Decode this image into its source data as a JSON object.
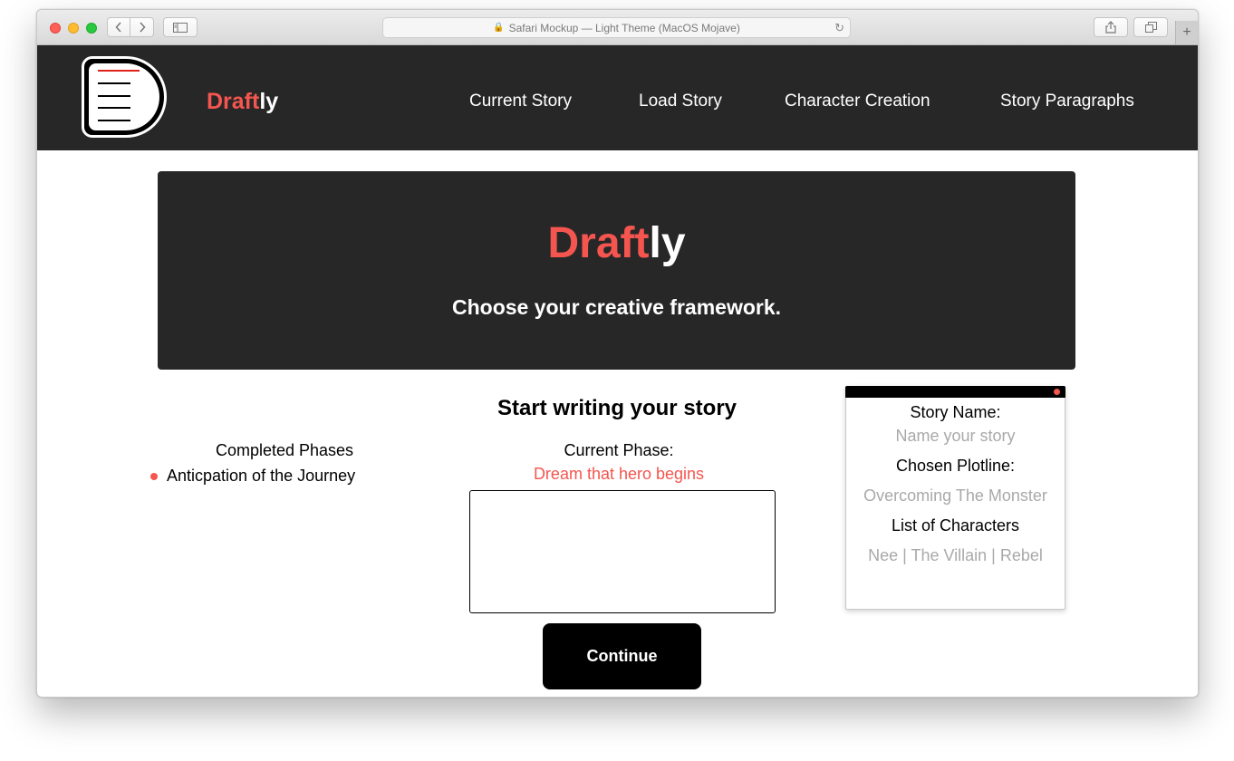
{
  "browser": {
    "address_text": "Safari Mockup — Light Theme (MacOS Mojave)",
    "back_icon": "chevron-left-icon",
    "forward_icon": "chevron-right-icon",
    "new_tab_label": "+"
  },
  "header": {
    "brand_accent": "Draft",
    "brand_rest": "ly",
    "nav": [
      "Current Story",
      "Load Story",
      "Character Creation",
      "Story Paragraphs"
    ]
  },
  "hero": {
    "title_accent": "Draft",
    "title_rest": "ly",
    "subtitle": "Choose your creative framework."
  },
  "main": {
    "title": "Start writing your story",
    "completed_title": "Completed Phases",
    "completed_items": [
      "Anticpation of the Journey"
    ],
    "current_label": "Current Phase:",
    "current_value": "Dream that hero begins",
    "story_text": "",
    "continue_label": "Continue"
  },
  "card": {
    "story_name_label": "Story Name:",
    "story_name_value": "Name your story",
    "plotline_label": "Chosen Plotline:",
    "plotline_value": "Overcoming The Monster",
    "characters_label": "List of Characters",
    "characters_value": "Nee | The Villain | Rebel"
  },
  "colors": {
    "accent": "#f5554f",
    "header_bg": "#272727",
    "muted": "#a9a9a9"
  }
}
